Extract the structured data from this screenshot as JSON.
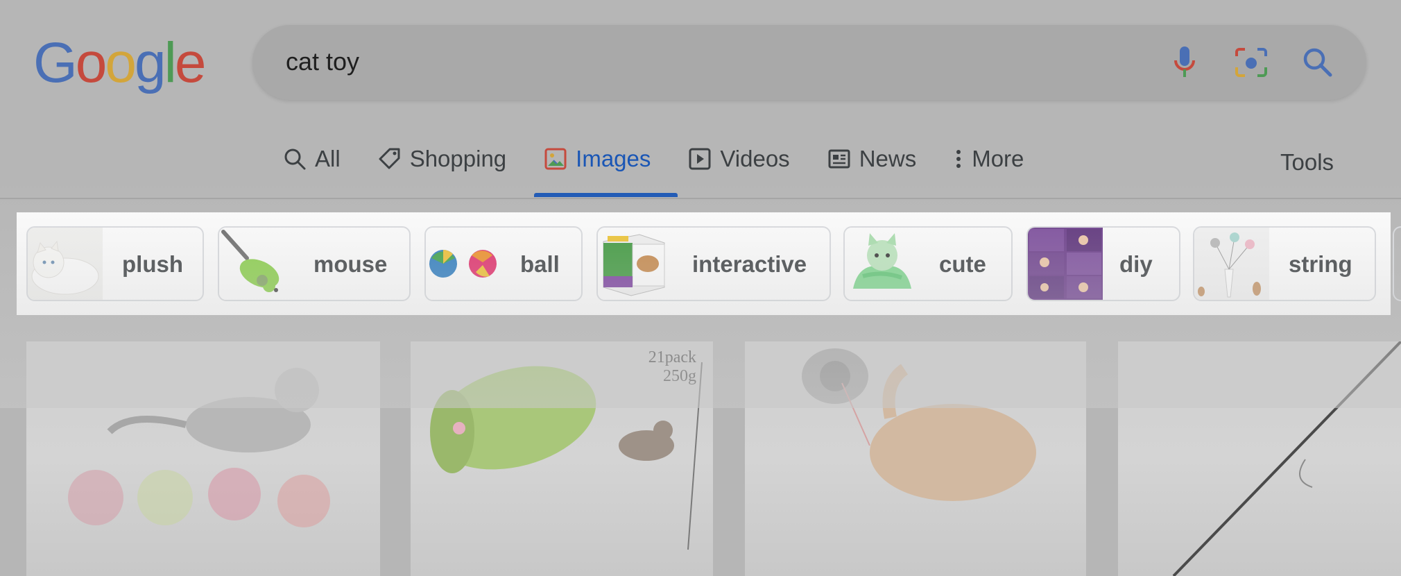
{
  "search": {
    "query": "cat toy"
  },
  "logo": {
    "letters": [
      "G",
      "o",
      "o",
      "g",
      "l",
      "e"
    ],
    "colors": [
      "#4a6fb5",
      "#c54a3d",
      "#d3a53a",
      "#4a6fb5",
      "#4e9a55",
      "#c54a3d"
    ]
  },
  "tabs": [
    {
      "label": "All",
      "icon": "search-icon"
    },
    {
      "label": "Shopping",
      "icon": "tag-icon"
    },
    {
      "label": "Images",
      "icon": "image-icon",
      "active": true
    },
    {
      "label": "Videos",
      "icon": "play-icon"
    },
    {
      "label": "News",
      "icon": "newspaper-icon"
    },
    {
      "label": "More",
      "icon": "more-vert-icon"
    }
  ],
  "tools_label": "Tools",
  "chips": [
    {
      "label": "plush",
      "thumb": "white-plush-cat"
    },
    {
      "label": "mouse",
      "thumb": "green-toy-mouse"
    },
    {
      "label": "ball",
      "thumb": "colorful-balls"
    },
    {
      "label": "interactive",
      "thumb": "interactive-cat-toy-box"
    },
    {
      "label": "cute",
      "thumb": "green-cat-plush"
    },
    {
      "label": "diy",
      "thumb": "diy-collage"
    },
    {
      "label": "string",
      "thumb": "string-feather-toys"
    }
  ],
  "results": [
    {
      "thumb": "kitten-with-yarn-balls"
    },
    {
      "thumb": "green-tunnel-toy-set",
      "badge_line1": "21pack",
      "badge_line2": "250g"
    },
    {
      "thumb": "laser-toy-with-kitten"
    },
    {
      "thumb": "wand-toy"
    }
  ],
  "colors": {
    "accent": "#1a56b5",
    "chip_border": "#dadce0"
  }
}
